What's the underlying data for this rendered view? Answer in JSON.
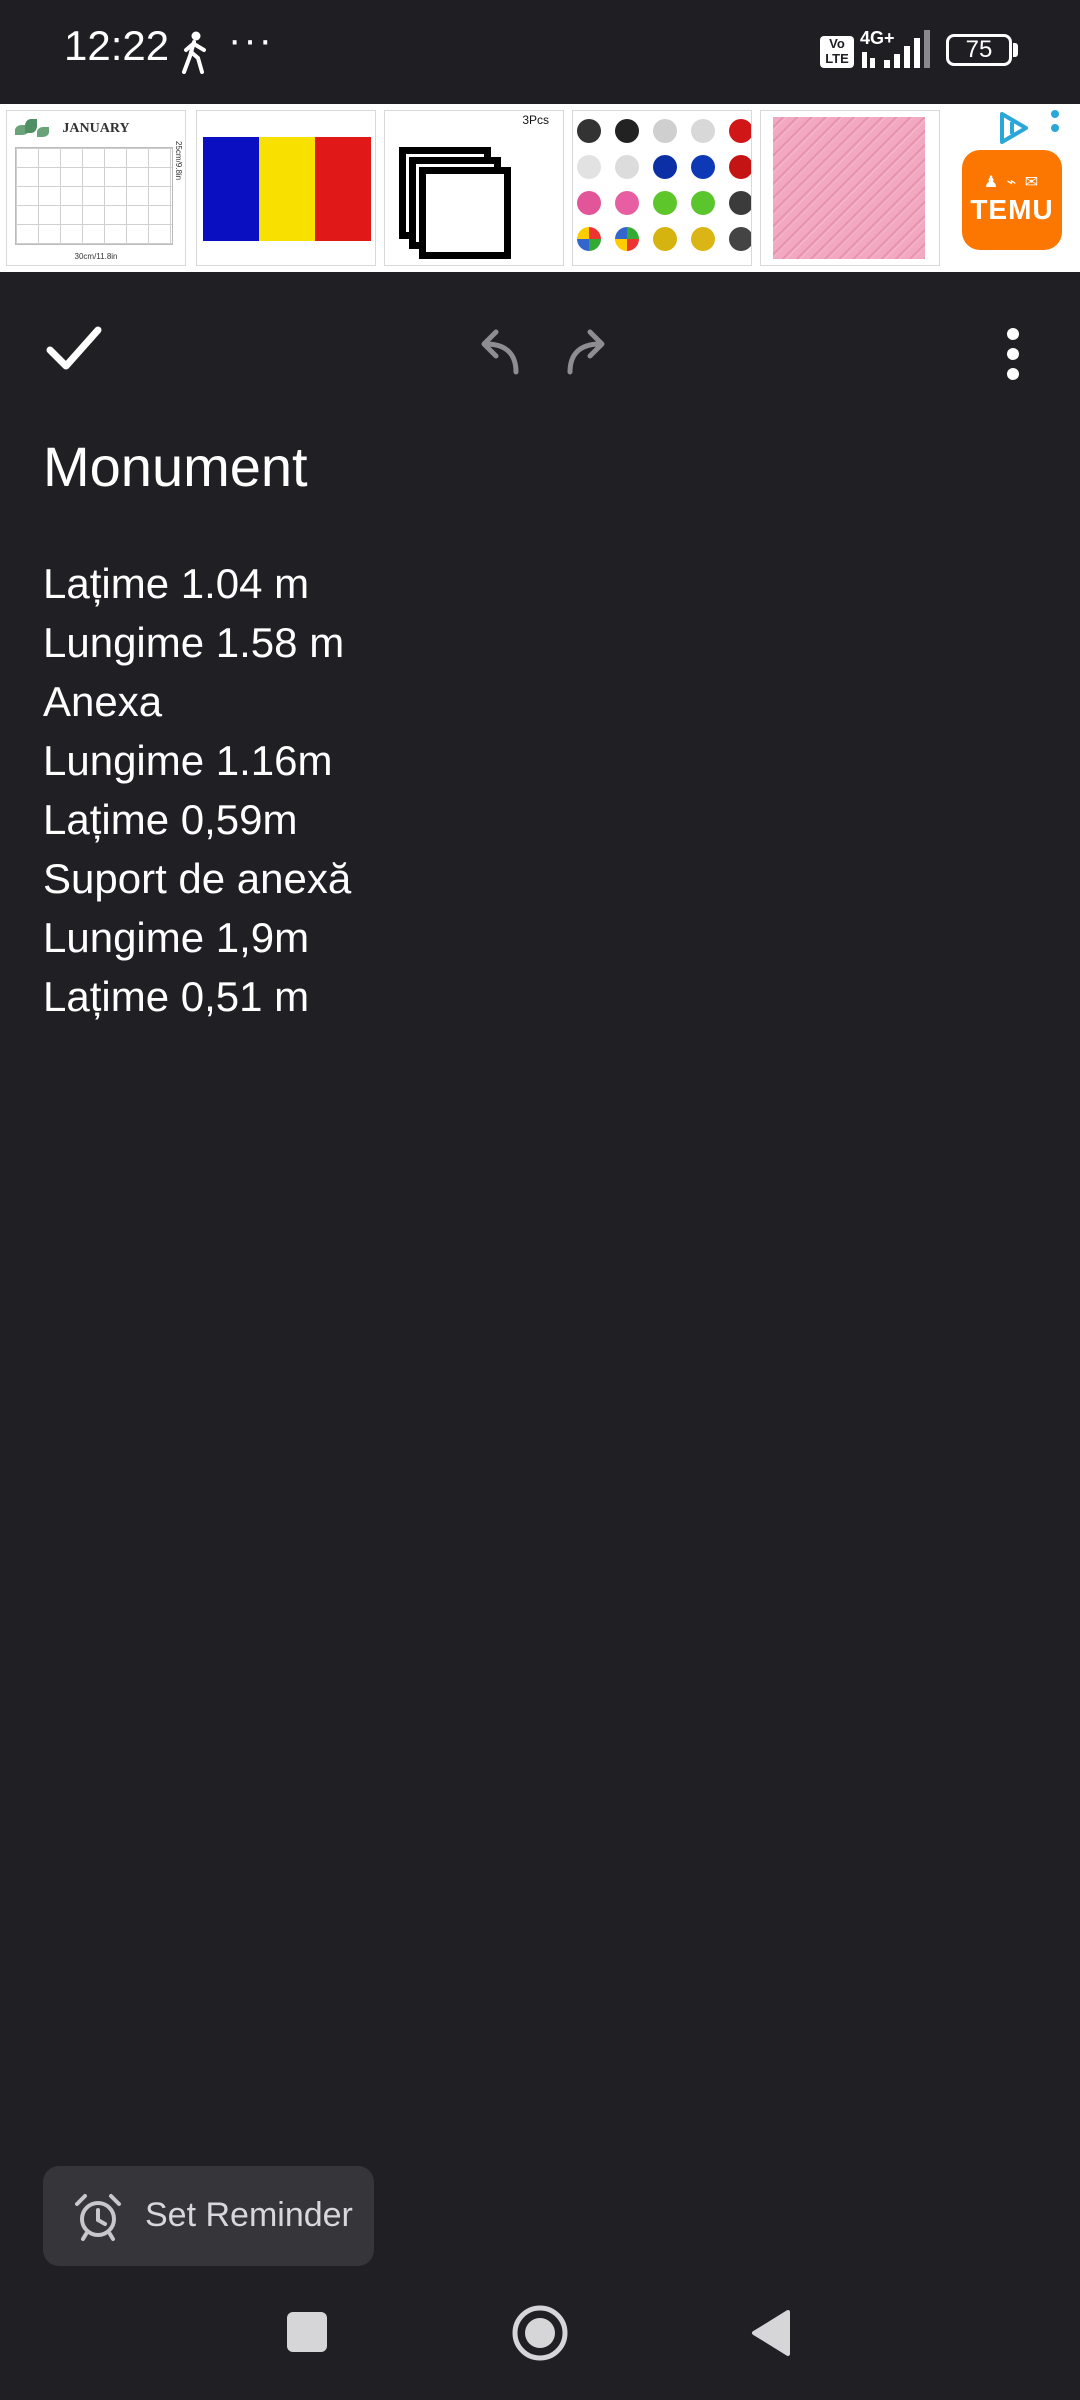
{
  "status_bar": {
    "time": "12:22",
    "dots": "···",
    "volte": "Vo\nLTE",
    "network": "4G+",
    "battery": "75"
  },
  "ad_banner": {
    "calendar_month": "JANUARY",
    "calendar_size_w": "30cm/11.8in",
    "calendar_size_h": "25cm/9.8in",
    "frames_label": "3Pcs",
    "brand": "TEMU",
    "colors": {
      "flag_blue": "#0a0fc2",
      "flag_yellow": "#f8e000",
      "flag_red": "#e01818",
      "temu_orange": "#fb7701",
      "ad_choice_blue": "#2aa7d9"
    }
  },
  "toolbar": {
    "icons": [
      "check-icon",
      "undo-icon",
      "redo-icon",
      "more-vert-icon"
    ]
  },
  "note": {
    "title": "Monument",
    "lines": [
      "Lațime 1.04 m",
      "Lungime 1.58 m",
      "Anexa",
      "Lungime 1.16m",
      "Lațime 0,59m",
      "Suport de anexă",
      "Lungime 1,9m",
      "Lațime 0,51 m"
    ]
  },
  "reminder": {
    "label": "Set Reminder",
    "icon": "alarm-icon"
  },
  "nav": {
    "icons": [
      "recents-icon",
      "home-icon",
      "back-icon"
    ]
  }
}
